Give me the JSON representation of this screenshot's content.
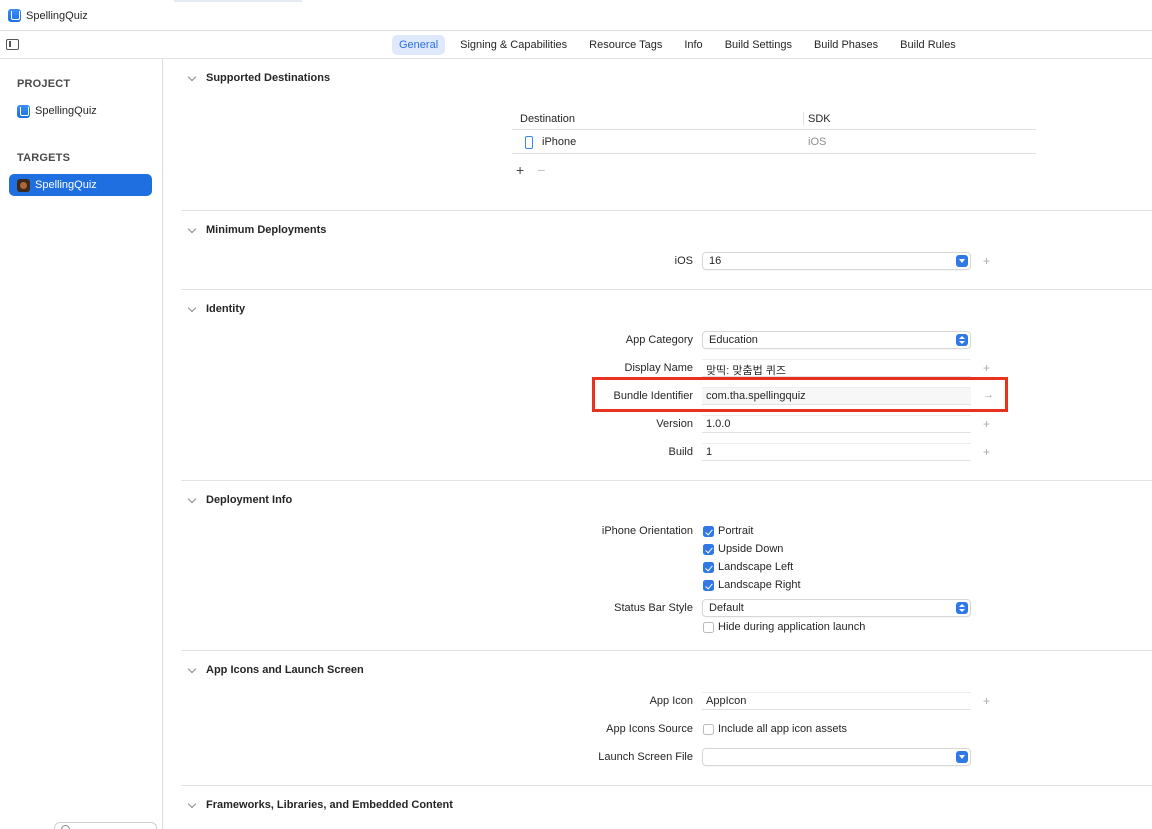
{
  "window": {
    "breadcrumb_title": "SpellingQuiz"
  },
  "tabs": [
    {
      "label": "General",
      "active": true
    },
    {
      "label": "Signing & Capabilities"
    },
    {
      "label": "Resource Tags"
    },
    {
      "label": "Info"
    },
    {
      "label": "Build Settings"
    },
    {
      "label": "Build Phases"
    },
    {
      "label": "Build Rules"
    }
  ],
  "sidebar": {
    "project_header": "PROJECT",
    "project_item": "SpellingQuiz",
    "targets_header": "TARGETS",
    "target_item": "SpellingQuiz"
  },
  "sections": {
    "supported_destinations": {
      "title": "Supported Destinations",
      "col_destination": "Destination",
      "col_sdk": "SDK",
      "rows": [
        {
          "destination": "iPhone",
          "sdk": "iOS"
        }
      ],
      "add": "+",
      "remove": "−"
    },
    "minimum_deployments": {
      "title": "Minimum Deployments",
      "ios_label": "iOS",
      "ios_value": "16"
    },
    "identity": {
      "title": "Identity",
      "app_category_label": "App Category",
      "app_category_value": "Education",
      "display_name_label": "Display Name",
      "display_name_value": "맞띡: 맞춤법 퀴즈",
      "bundle_identifier_label": "Bundle Identifier",
      "bundle_identifier_value": "com.tha.spellingquiz",
      "version_label": "Version",
      "version_value": "1.0.0",
      "build_label": "Build",
      "build_value": "1"
    },
    "deployment_info": {
      "title": "Deployment Info",
      "orientation_label": "iPhone Orientation",
      "orientations": [
        {
          "label": "Portrait",
          "checked": true
        },
        {
          "label": "Upside Down",
          "checked": true
        },
        {
          "label": "Landscape Left",
          "checked": true
        },
        {
          "label": "Landscape Right",
          "checked": true
        }
      ],
      "status_bar_label": "Status Bar Style",
      "status_bar_value": "Default",
      "hide_launch_label": "Hide during application launch",
      "hide_launch_checked": false
    },
    "app_icons": {
      "title": "App Icons and Launch Screen",
      "app_icon_label": "App Icon",
      "app_icon_value": "AppIcon",
      "app_icons_source_label": "App Icons Source",
      "include_all_label": "Include all app icon assets",
      "include_all_checked": false,
      "launch_screen_label": "Launch Screen File",
      "launch_screen_value": ""
    },
    "frameworks": {
      "title": "Frameworks, Libraries, and Embedded Content"
    }
  },
  "icons": {
    "plus": "+",
    "arrow": "→"
  },
  "colors": {
    "accent": "#2f78e6",
    "selection": "#1f6fe0",
    "highlight_box": "#e8321d"
  }
}
